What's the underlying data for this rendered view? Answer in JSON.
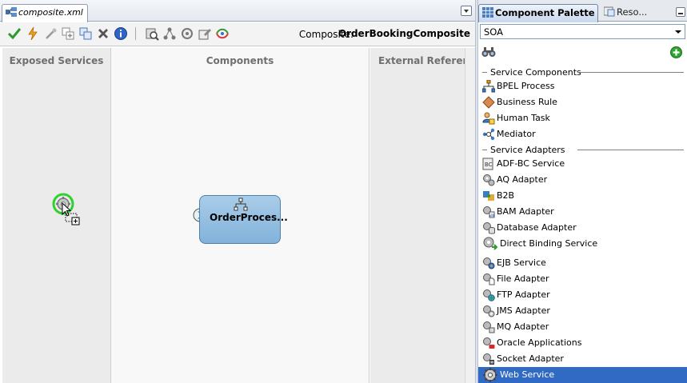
{
  "editor": {
    "tab_label": "composite.xml",
    "composite_label": "Composite:",
    "composite_name": "OrderBookingComposite"
  },
  "toolbar": {
    "icons": [
      "validate-icon",
      "deploy-icon",
      "wire-icon",
      "add-icon",
      "copy-icon",
      "delete-icon",
      "info-icon",
      "test-icon",
      "layout-icon",
      "refresh-icon",
      "edit-icon",
      "flow-icon"
    ]
  },
  "canvas": {
    "exposed_title": "Exposed Services",
    "components_title": "Components",
    "external_title": "External References",
    "component_label": "OrderProces..."
  },
  "palette": {
    "tab_active": "Component Palette",
    "tab_inactive": "Reso...",
    "selected_category": "SOA",
    "sections": {
      "service_components": "Service Components",
      "service_adapters": "Service Adapters"
    },
    "service_components": [
      {
        "label": "BPEL Process",
        "icon": "bpel-process-icon"
      },
      {
        "label": "Business Rule",
        "icon": "business-rule-icon"
      },
      {
        "label": "Human Task",
        "icon": "human-task-icon"
      },
      {
        "label": "Mediator",
        "icon": "mediator-icon"
      }
    ],
    "service_adapters": [
      {
        "label": "ADF-BC Service",
        "icon": "adf-bc-icon"
      },
      {
        "label": "AQ Adapter",
        "icon": "aq-adapter-icon"
      },
      {
        "label": "B2B",
        "icon": "b2b-icon"
      },
      {
        "label": "BAM Adapter",
        "icon": "bam-adapter-icon"
      },
      {
        "label": "Database Adapter",
        "icon": "database-adapter-icon"
      },
      {
        "label": "Direct Binding Service",
        "icon": "direct-binding-icon"
      },
      {
        "label": "EJB Service",
        "icon": "ejb-service-icon"
      },
      {
        "label": "File Adapter",
        "icon": "file-adapter-icon"
      },
      {
        "label": "FTP Adapter",
        "icon": "ftp-adapter-icon"
      },
      {
        "label": "JMS Adapter",
        "icon": "jms-adapter-icon"
      },
      {
        "label": "MQ Adapter",
        "icon": "mq-adapter-icon"
      },
      {
        "label": "Oracle Applications",
        "icon": "oracle-applications-icon"
      },
      {
        "label": "Socket Adapter",
        "icon": "socket-adapter-icon"
      },
      {
        "label": "Web Service",
        "icon": "web-service-icon"
      }
    ],
    "selected_item": "Web Service"
  }
}
